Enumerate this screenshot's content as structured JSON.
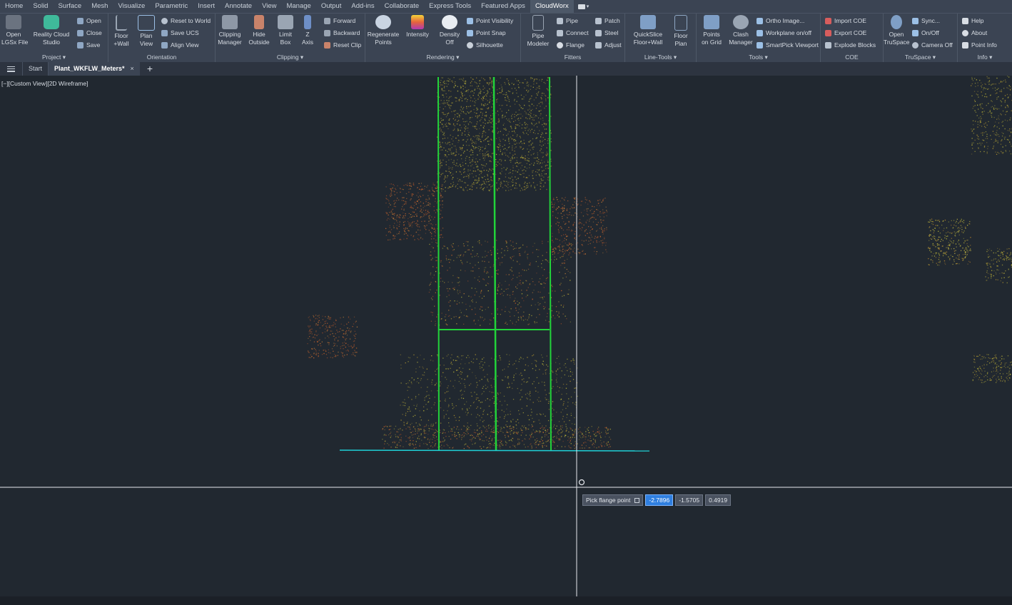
{
  "menu_tabs": [
    "Home",
    "Solid",
    "Surface",
    "Mesh",
    "Visualize",
    "Parametric",
    "Insert",
    "Annotate",
    "View",
    "Manage",
    "Output",
    "Add-ins",
    "Collaborate",
    "Express Tools",
    "Featured Apps",
    "CloudWorx"
  ],
  "active_menu_tab": "CloudWorx",
  "ribbon": {
    "project": {
      "title": "Project ▾",
      "open_lgsx": "Open\nLGSx File",
      "reality_cloud": "Reality Cloud\nStudio",
      "open": "Open",
      "close": "Close",
      "save": "Save"
    },
    "orientation": {
      "title": "Orientation",
      "floor_wall": "Floor\n+Wall",
      "plan_view": "Plan\nView",
      "reset_world": "Reset to World",
      "save_ucs": "Save UCS",
      "align_view": "Align View"
    },
    "clipping": {
      "title": "Clipping ▾",
      "manager": "Clipping\nManager",
      "hide_outside": "Hide\nOutside",
      "limit_box": "Limit\nBox",
      "z_axis": "Z\nAxis",
      "forward": "Forward",
      "backward": "Backward",
      "reset_clip": "Reset Clip"
    },
    "rendering": {
      "title": "Rendering ▾",
      "regenerate": "Regenerate\nPoints",
      "intensity": "Intensity",
      "density": "Density\nOff",
      "point_visibility": "Point Visibility",
      "point_snap": "Point Snap",
      "silhouette": "Silhouette"
    },
    "fitters": {
      "title": "Fitters",
      "pipe_modeler": "Pipe\nModeler",
      "pipe": "Pipe",
      "connect": "Connect",
      "flange": "Flange",
      "patch": "Patch",
      "steel": "Steel",
      "adjust": "Adjust"
    },
    "linetools": {
      "title": "Line-Tools ▾",
      "quickslice": "QuickSlice\nFloor+Wall",
      "floor_plan": "Floor\nPlan"
    },
    "tools": {
      "title": "Tools ▾",
      "points_grid": "Points\non Grid",
      "clash_manager": "Clash\nManager",
      "ortho_image": "Ortho Image...",
      "workplane": "Workplane on/off",
      "smartpick": "SmartPick Viewport"
    },
    "coe": {
      "title": "COE",
      "import_coe": "Import COE",
      "export_coe": "Export COE",
      "explode_blocks": "Explode Blocks"
    },
    "truspace": {
      "title": "TruSpace ▾",
      "open_truspace": "Open\nTruSpace",
      "sync": "Sync...",
      "onoff": "On/Off",
      "camera_off": "Camera Off"
    },
    "info": {
      "title": "Info ▾",
      "help": "Help",
      "about": "About",
      "point_info": "Point Info"
    }
  },
  "doc_tabs": {
    "start": "Start",
    "active": "Plant_WKFLW_Meters*",
    "close": "×",
    "add": "+"
  },
  "viewport": {
    "label": "[−][Custom View][2D Wireframe]"
  },
  "prompt": {
    "label": "Pick flange point",
    "x": "-2.7896",
    "y": "-1.5705",
    "z": "0.4919"
  },
  "colors": {
    "accent": "#2f7fe0",
    "green_model": "#22d33a",
    "cyan_line": "#1fd0d6",
    "point_yellow": "#c9c23a",
    "point_orange": "#d2692c"
  }
}
